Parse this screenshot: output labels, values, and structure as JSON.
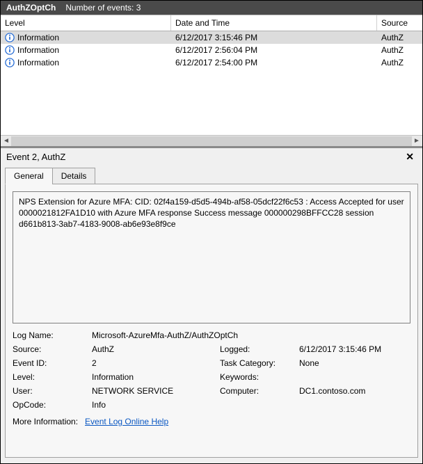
{
  "titlebar": {
    "title": "AuthZOptCh",
    "count_label": "Number of events: 3"
  },
  "columns": {
    "level": "Level",
    "date": "Date and Time",
    "source": "Source"
  },
  "rows": [
    {
      "level": "Information",
      "date": "6/12/2017 3:15:46 PM",
      "source": "AuthZ",
      "selected": true
    },
    {
      "level": "Information",
      "date": "6/12/2017 2:56:04 PM",
      "source": "AuthZ",
      "selected": false
    },
    {
      "level": "Information",
      "date": "6/12/2017 2:54:00 PM",
      "source": "AuthZ",
      "selected": false
    }
  ],
  "detail": {
    "header": "Event 2, AuthZ",
    "tabs": {
      "general": "General",
      "details": "Details"
    },
    "message": "NPS Extension for Azure MFA:  CID: 02f4a159-d5d5-494b-af58-05dcf22f6c53 : Access Accepted for user 0000021812FA1D10 with Azure MFA response Success message 000000298BFFCC28 session d661b813-3ab7-4183-9008-ab6e93e8f9ce",
    "labels": {
      "log_name": "Log Name:",
      "source": "Source:",
      "logged": "Logged:",
      "event_id": "Event ID:",
      "task_cat": "Task Category:",
      "level": "Level:",
      "keywords": "Keywords:",
      "user": "User:",
      "computer": "Computer:",
      "opcode": "OpCode:",
      "more_info": "More Information:"
    },
    "values": {
      "log_name": "Microsoft-AzureMfa-AuthZ/AuthZOptCh",
      "source": "AuthZ",
      "logged": "6/12/2017 3:15:46 PM",
      "event_id": "2",
      "task_cat": "None",
      "level": "Information",
      "keywords": "",
      "user": "NETWORK SERVICE",
      "computer": "DC1.contoso.com",
      "opcode": "Info",
      "more_info_link": "Event Log Online Help"
    }
  }
}
